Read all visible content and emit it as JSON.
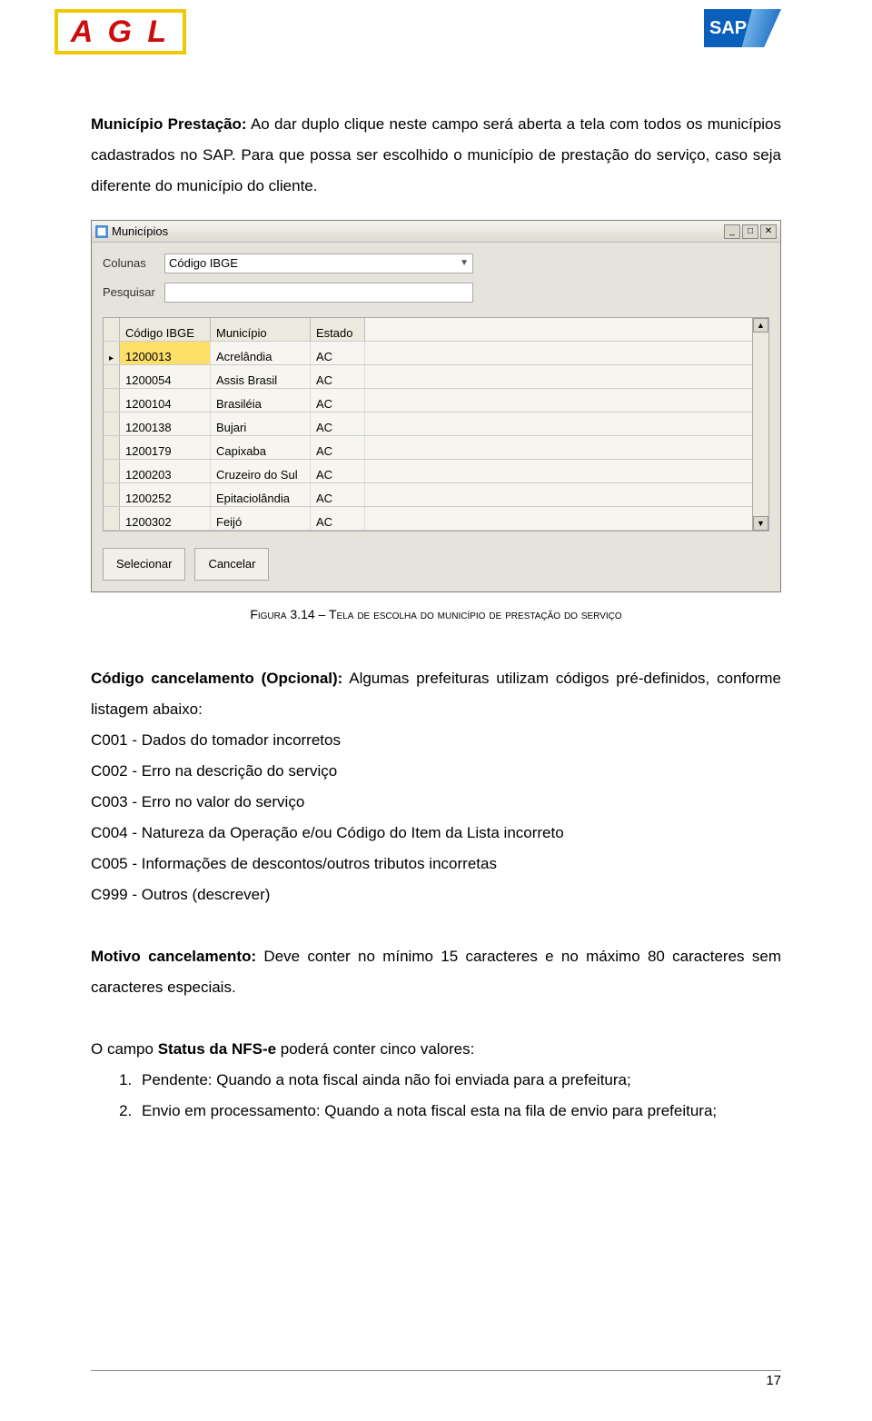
{
  "logos": {
    "agl": "A G L",
    "sap": "SAP"
  },
  "para1": {
    "label": "Município Prestação:",
    "text": " Ao dar duplo clique neste campo será aberta a tela com todos os municípios cadastrados no SAP. Para que possa ser escolhido o município de prestação do serviço, caso seja diferente do município do cliente."
  },
  "window": {
    "title": "Municípios",
    "filters": {
      "col_label": "Colunas",
      "col_value": "Código IBGE",
      "search_label": "Pesquisar",
      "search_value": ""
    },
    "headers": {
      "c1": "Código IBGE",
      "c2": "Município",
      "c3": "Estado"
    },
    "rows": [
      {
        "c1": "1200013",
        "c2": "Acrelândia",
        "c3": "AC",
        "selected": true
      },
      {
        "c1": "1200054",
        "c2": "Assis Brasil",
        "c3": "AC"
      },
      {
        "c1": "1200104",
        "c2": "Brasiléia",
        "c3": "AC"
      },
      {
        "c1": "1200138",
        "c2": "Bujari",
        "c3": "AC"
      },
      {
        "c1": "1200179",
        "c2": "Capixaba",
        "c3": "AC"
      },
      {
        "c1": "1200203",
        "c2": "Cruzeiro do Sul",
        "c3": "AC"
      },
      {
        "c1": "1200252",
        "c2": "Epitaciolândia",
        "c3": "AC"
      },
      {
        "c1": "1200302",
        "c2": "Feijó",
        "c3": "AC"
      }
    ],
    "buttons": {
      "select": "Selecionar",
      "cancel": "Cancelar"
    }
  },
  "caption": "Figura 3.14 – Tela de escolha do município de prestação do serviço",
  "para2": {
    "label": "Código cancelamento (Opcional):",
    "text": " Algumas prefeituras utilizam códigos pré-definidos, conforme listagem abaixo:"
  },
  "codes": [
    "C001 - Dados do tomador incorretos",
    "C002 - Erro na descrição do serviço",
    "C003 - Erro no valor do serviço",
    "C004 - Natureza da Operação e/ou Código do Item da Lista incorreto",
    "C005 - Informações de descontos/outros tributos incorretas",
    "C999 -  Outros (descrever)"
  ],
  "para3": {
    "label": "Motivo cancelamento:",
    "text": " Deve conter no mínimo 15 caracteres e no máximo 80 caracteres sem caracteres especiais."
  },
  "para4": {
    "pre": "O campo ",
    "label": "Status da NFS-e",
    "post": " poderá conter cinco valores:"
  },
  "olist": [
    "Pendente: Quando a nota fiscal ainda não foi enviada para a prefeitura;",
    "Envio em processamento: Quando a nota fiscal esta na fila de envio para prefeitura;"
  ],
  "pagenum": "17"
}
